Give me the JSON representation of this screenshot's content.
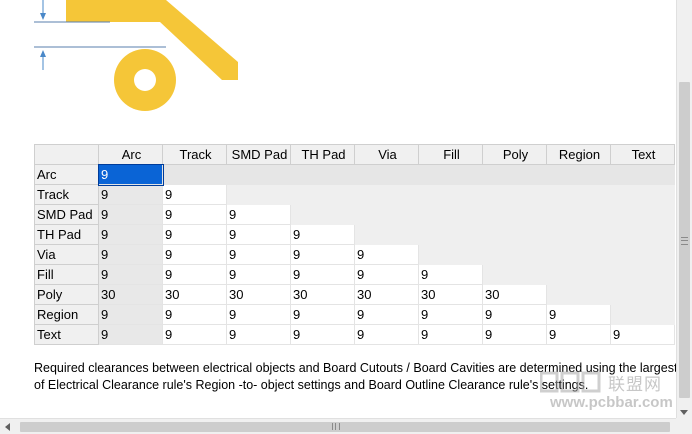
{
  "matrix": {
    "columns": [
      "Arc",
      "Track",
      "SMD Pad",
      "TH Pad",
      "Via",
      "Fill",
      "Poly",
      "Region",
      "Text"
    ],
    "rows": [
      {
        "label": "Arc",
        "values": [
          "9"
        ]
      },
      {
        "label": "Track",
        "values": [
          "9",
          "9"
        ]
      },
      {
        "label": "SMD Pad",
        "values": [
          "9",
          "9",
          "9"
        ]
      },
      {
        "label": "TH Pad",
        "values": [
          "9",
          "9",
          "9",
          "9"
        ]
      },
      {
        "label": "Via",
        "values": [
          "9",
          "9",
          "9",
          "9",
          "9"
        ]
      },
      {
        "label": "Fill",
        "values": [
          "9",
          "9",
          "9",
          "9",
          "9",
          "9"
        ]
      },
      {
        "label": "Poly",
        "values": [
          "30",
          "30",
          "30",
          "30",
          "30",
          "30",
          "30"
        ]
      },
      {
        "label": "Region",
        "values": [
          "9",
          "9",
          "9",
          "9",
          "9",
          "9",
          "9",
          "9"
        ]
      },
      {
        "label": "Text",
        "values": [
          "9",
          "9",
          "9",
          "9",
          "9",
          "9",
          "9",
          "9",
          "9"
        ]
      }
    ],
    "selected_cell": {
      "row": 0,
      "col": 0
    }
  },
  "description": {
    "line1": "Required clearances between electrical objects and Board Cutouts / Board Cavities are determined using the largest",
    "line2": "of Electrical Clearance rule's Region -to- object settings and Board Outline Clearance rule's settings."
  },
  "watermark": {
    "brand": "联盟网",
    "url": "www.pcbbar.com"
  },
  "colors": {
    "track": "#f5c638",
    "dimension_line": "#4a88c8",
    "selection": "#0a64d6"
  }
}
